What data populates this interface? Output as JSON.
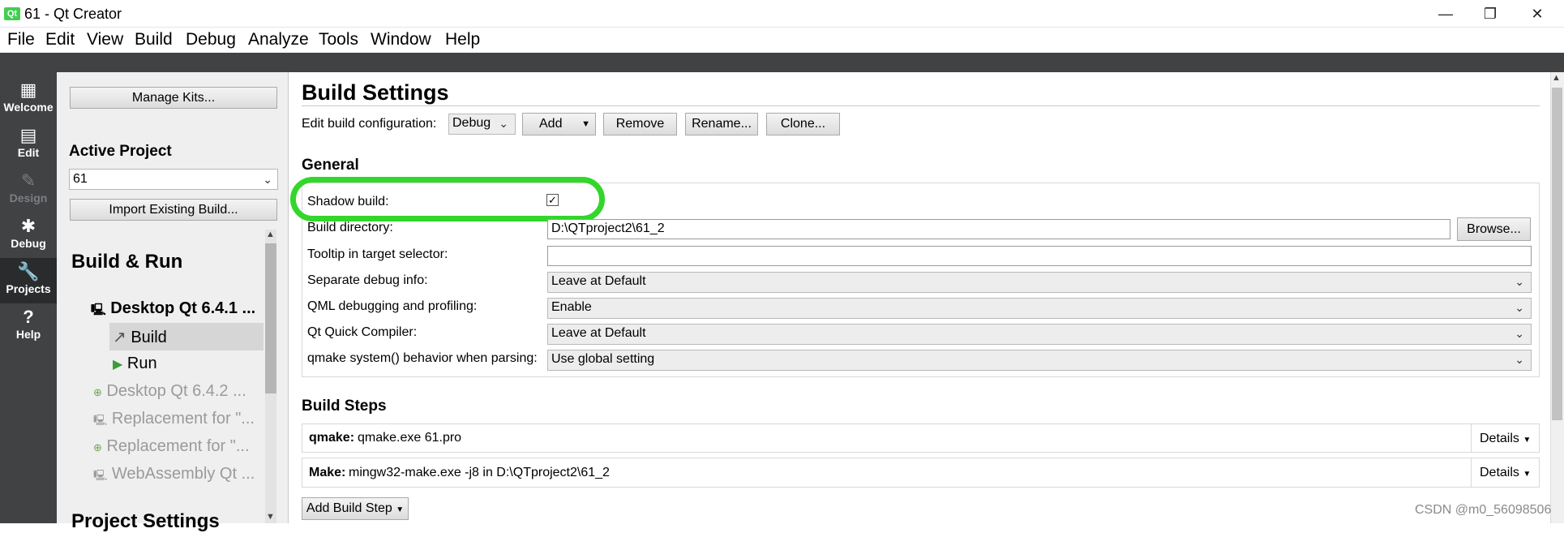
{
  "window": {
    "title": "61 - Qt Creator",
    "logo_text": "Qt",
    "min_icon": "—",
    "max_icon": "❐",
    "close_icon": "✕"
  },
  "menu": [
    "File",
    "Edit",
    "View",
    "Build",
    "Debug",
    "Analyze",
    "Tools",
    "Window",
    "Help"
  ],
  "modes": [
    {
      "label": "Welcome",
      "icon": "▦"
    },
    {
      "label": "Edit",
      "icon": "▤"
    },
    {
      "label": "Design",
      "icon": "✎"
    },
    {
      "label": "Debug",
      "icon": "✱"
    },
    {
      "label": "Projects",
      "icon": "🔧"
    },
    {
      "label": "Help",
      "icon": "?"
    }
  ],
  "sidebar": {
    "manage_kits": "Manage Kits...",
    "active_project_label": "Active Project",
    "active_project_value": "61",
    "import_button": "Import Existing Build...",
    "build_run_label": "Build & Run",
    "kits": [
      {
        "name": "Desktop Qt 6.4.1 ..."
      },
      {
        "name": "Build"
      },
      {
        "name": "Run"
      },
      {
        "name": "Desktop Qt 6.4.2 ..."
      },
      {
        "name": "Replacement for \"..."
      },
      {
        "name": "Replacement for \"..."
      },
      {
        "name": "WebAssembly Qt ..."
      }
    ],
    "project_settings_label": "Project Settings"
  },
  "main": {
    "title": "Build Settings",
    "edit_config_label": "Edit build configuration:",
    "config_value": "Debug",
    "add_button": "Add",
    "remove_button": "Remove",
    "rename_button": "Rename...",
    "clone_button": "Clone...",
    "general_label": "General",
    "shadow_build_label": "Shadow build:",
    "shadow_build_checked": true,
    "build_dir_label": "Build directory:",
    "build_dir_value": "D:\\QTproject2\\61_2",
    "browse_button": "Browse...",
    "tooltip_label": "Tooltip in target selector:",
    "tooltip_value": "",
    "sep_debug_label": "Separate debug info:",
    "sep_debug_value": "Leave at Default",
    "qml_label": "QML debugging and profiling:",
    "qml_value": "Enable",
    "quick_label": "Qt Quick Compiler:",
    "quick_value": "Leave at Default",
    "qmake_label": "qmake system() behavior when parsing:",
    "qmake_value": "Use global setting",
    "build_steps_label": "Build Steps",
    "steps": [
      {
        "name": "qmake:",
        "detail": "qmake.exe 61.pro",
        "details_button": "Details"
      },
      {
        "name": "Make:",
        "detail": "mingw32-make.exe -j8 in D:\\QTproject2\\61_2",
        "details_button": "Details"
      }
    ],
    "add_build_step": "Add Build Step"
  },
  "watermark": "CSDN @m0_56098506",
  "accent_color": "#33d62b"
}
